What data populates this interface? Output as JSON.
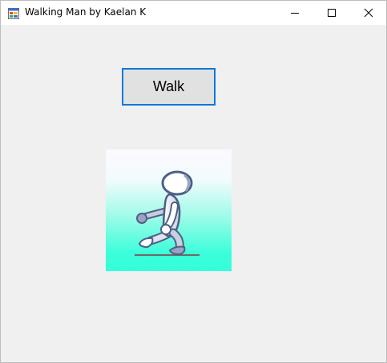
{
  "window": {
    "title": "Walking Man by Kaelan K"
  },
  "main": {
    "walk_button_label": "Walk"
  },
  "colors": {
    "window_bg": "#f0f0f0",
    "titlebar_bg": "#ffffff",
    "button_bg": "#e1e1e1",
    "button_focus_border": "#0078d7",
    "gradient_top": "#fdf9ff",
    "gradient_bottom": "#33ffd9"
  },
  "icons": [
    "app-icon",
    "minimize-icon",
    "maximize-icon",
    "close-icon",
    "walking-man-image"
  ]
}
